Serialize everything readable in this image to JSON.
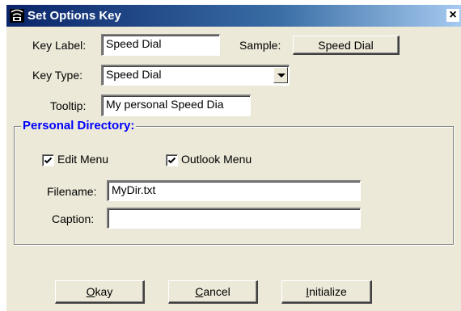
{
  "window": {
    "title": "Set Options Key",
    "close_label": "×"
  },
  "key_label": {
    "label": "Key Label:",
    "value": "Speed Dial"
  },
  "sample": {
    "label": "Sample:",
    "button_label": "Speed Dial"
  },
  "key_type": {
    "label": "Key Type:",
    "value": "Speed Dial"
  },
  "tooltip": {
    "label": "Tooltip:",
    "value": "My personal Speed Dia"
  },
  "personal_directory": {
    "title": "Personal Directory:",
    "edit_menu": {
      "label": "Edit Menu",
      "checked": true
    },
    "outlook_menu": {
      "label": "Outlook Menu",
      "checked": true
    },
    "filename": {
      "label": "Filename:",
      "value": "MyDir.txt"
    },
    "caption": {
      "label": "Caption:",
      "value": ""
    }
  },
  "buttons": {
    "okay": {
      "mnemonic": "O",
      "rest": "kay"
    },
    "cancel": {
      "mnemonic": "C",
      "rest": "ancel"
    },
    "initialize": {
      "mnemonic": "I",
      "rest": "nitialize"
    }
  }
}
